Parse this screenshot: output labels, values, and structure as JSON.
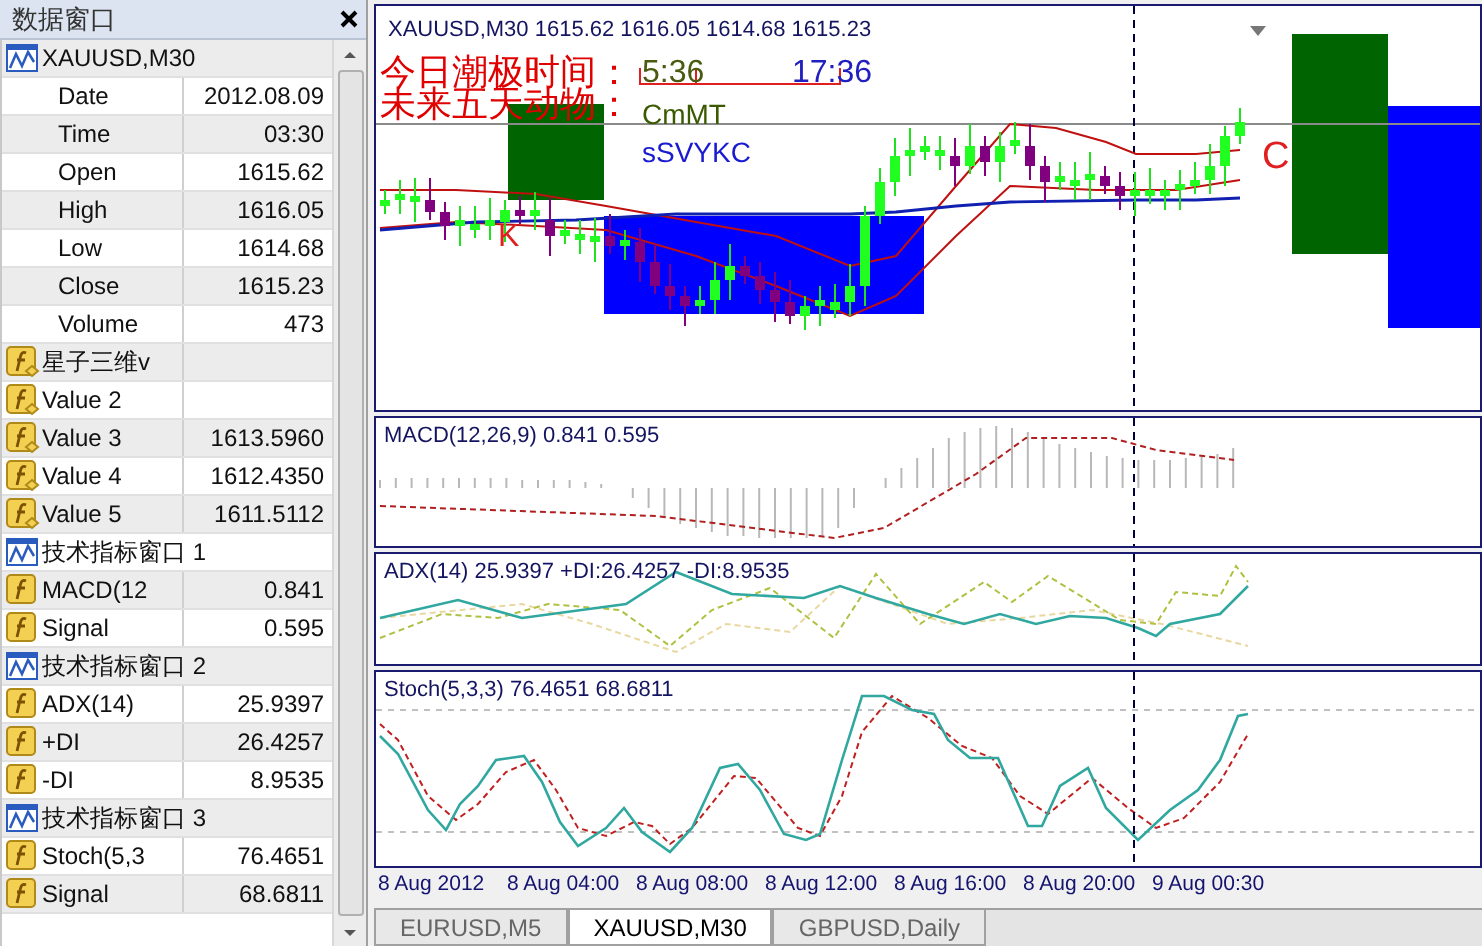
{
  "data_window": {
    "title": "数据窗口",
    "rows": [
      {
        "kind": "symbol",
        "label": "XAUUSD,M30"
      },
      {
        "kind": "field",
        "label": "Date",
        "value": "2012.08.09"
      },
      {
        "kind": "field",
        "label": "Time",
        "value": "03:30"
      },
      {
        "kind": "field",
        "label": "Open",
        "value": "1615.62"
      },
      {
        "kind": "field",
        "label": "High",
        "value": "1616.05"
      },
      {
        "kind": "field",
        "label": "Low",
        "value": "1614.68"
      },
      {
        "kind": "field",
        "label": "Close",
        "value": "1615.23"
      },
      {
        "kind": "field",
        "label": "Volume",
        "value": "473"
      },
      {
        "kind": "custom_indicator",
        "label": "星子三维v"
      },
      {
        "kind": "custom_indicator",
        "label": "Value 2"
      },
      {
        "kind": "custom_indicator",
        "label": "Value 3",
        "value": "1613.5960"
      },
      {
        "kind": "custom_indicator",
        "label": "Value 4",
        "value": "1612.4350"
      },
      {
        "kind": "custom_indicator",
        "label": "Value 5",
        "value": "1611.5112"
      },
      {
        "kind": "window",
        "label": "技术指标窗口 1"
      },
      {
        "kind": "indicator",
        "label": "MACD(12",
        "value": "0.841"
      },
      {
        "kind": "indicator",
        "label": "Signal",
        "value": "0.595"
      },
      {
        "kind": "window",
        "label": "技术指标窗口 2"
      },
      {
        "kind": "indicator",
        "label": "ADX(14)",
        "value": "25.9397"
      },
      {
        "kind": "indicator",
        "label": "+DI",
        "value": "26.4257"
      },
      {
        "kind": "indicator",
        "label": "-DI",
        "value": "8.9535"
      },
      {
        "kind": "window",
        "label": "技术指标窗口 3"
      },
      {
        "kind": "indicator",
        "label": "Stoch(5,3",
        "value": "76.4651"
      },
      {
        "kind": "indicator",
        "label": "Signal",
        "value": "68.6811"
      }
    ]
  },
  "chart": {
    "header": "XAUUSD,M30 1615.62 1616.05 1614.68 1615.23",
    "tide_label": "今日潮极时间：",
    "tide_time_1": "5:36",
    "tide_time_2": "17:36",
    "animal_label": "未来五天动物：",
    "animal_1": "CmMT",
    "animal_2": "sSVYKC",
    "mark_k": "K",
    "mark_c": "C"
  },
  "indicator_panels": [
    {
      "kind": "macd",
      "label": "MACD(12,26,9) 0.841 0.595"
    },
    {
      "kind": "adx",
      "label": "ADX(14) 25.9397 +DI:26.4257 -DI:8.9535"
    },
    {
      "kind": "stoch",
      "label": "Stoch(5,3,3) 76.4651 68.6811"
    }
  ],
  "x_axis": [
    "8 Aug 2012",
    "8 Aug 04:00",
    "8 Aug 08:00",
    "8 Aug 12:00",
    "8 Aug 16:00",
    "8 Aug 20:00",
    "9 Aug 00:30"
  ],
  "tabs": [
    {
      "label": "EURUSD,M5",
      "selected": false
    },
    {
      "label": "XAUUSD,M30",
      "selected": true
    },
    {
      "label": "GBPUSD,Daily",
      "selected": false
    }
  ]
}
